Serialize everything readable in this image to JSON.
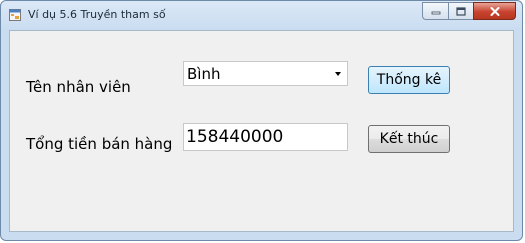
{
  "window": {
    "title": "Ví dụ 5.6 Truyền tham số",
    "icons": {
      "app": "app-form-icon",
      "minimize": "minimize-icon",
      "maximize": "maximize-icon",
      "close": "close-icon"
    }
  },
  "form": {
    "employee_label": "Tên nhân viên",
    "employee_selected": "Bình",
    "total_label": "Tổng tiền bán hàng",
    "total_value": "158440000",
    "stats_button": "Thống kê",
    "exit_button": "Kết thúc"
  },
  "colors": {
    "titlebar": "#c9dcf0",
    "client": "#f0f0f0",
    "close_button": "#c7432f",
    "default_button_border": "#3c7fb1"
  }
}
